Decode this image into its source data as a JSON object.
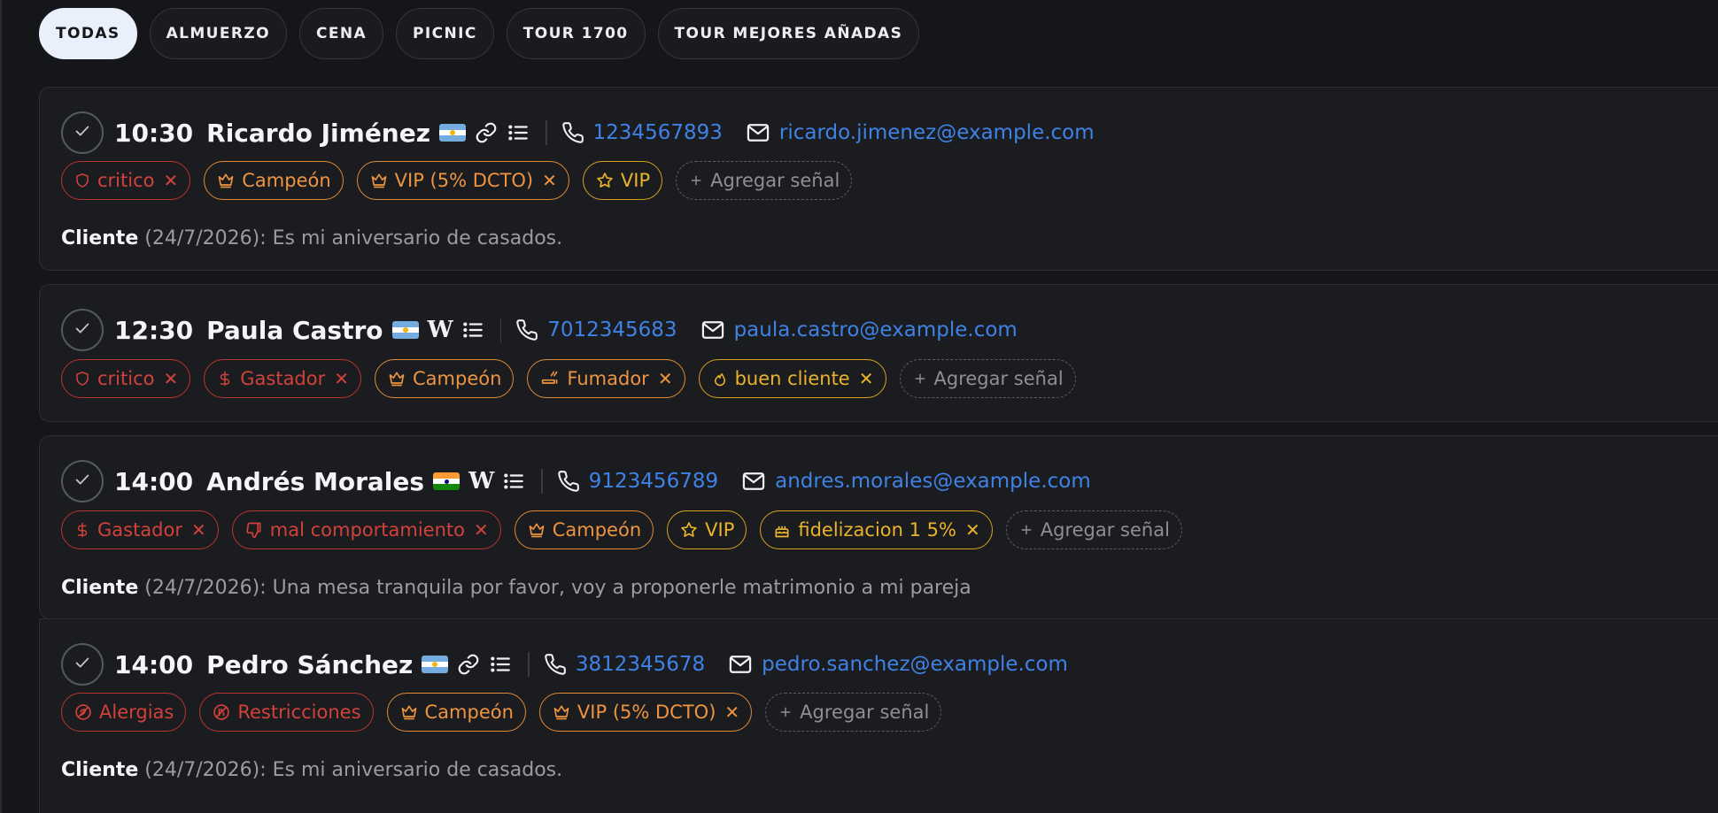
{
  "filters": [
    "TODAS",
    "ALMUERZO",
    "CENA",
    "PICNIC",
    "TOUR 1700",
    "TOUR MEJORES AÑADAS"
  ],
  "colors": {
    "red": "#d2413a",
    "orange": "#ee9440",
    "yellow": "#e9b32b",
    "link": "#3f82e6",
    "background": "#151619"
  },
  "add_signal_label": "Agregar señal",
  "reservations": [
    {
      "time": "10:30",
      "name": "Ricardo Jiménez",
      "flag": "argentina-flag",
      "icons": [
        "link-icon",
        "list-icon"
      ],
      "phone": "1234567893",
      "email": "ricardo.jimenez@example.com",
      "tags": [
        {
          "label": "critico",
          "color": "red",
          "icon": "shield-icon",
          "removable": true
        },
        {
          "label": "Campeón",
          "color": "orange",
          "icon": "crown-icon",
          "removable": false
        },
        {
          "label": "VIP (5% DCTO)",
          "color": "orange",
          "icon": "crown-icon",
          "removable": true
        },
        {
          "label": "VIP",
          "color": "yellow",
          "icon": "star-icon",
          "removable": false
        }
      ],
      "note": {
        "author": "Cliente",
        "date": "(24/7/2026):",
        "text": "Es mi aniversario de casados."
      }
    },
    {
      "time": "12:30",
      "name": "Paula Castro",
      "flag": "argentina-flag",
      "icons": [
        "w-icon",
        "list-icon"
      ],
      "phone": "7012345683",
      "email": "paula.castro@example.com",
      "tags": [
        {
          "label": "critico",
          "color": "red",
          "icon": "shield-icon",
          "removable": true
        },
        {
          "label": "Gastador",
          "color": "red",
          "icon": "dollar-icon",
          "removable": true
        },
        {
          "label": "Campeón",
          "color": "orange",
          "icon": "crown-icon",
          "removable": false
        },
        {
          "label": "Fumador",
          "color": "orange",
          "icon": "cigarette-icon",
          "removable": true
        },
        {
          "label": "buen cliente",
          "color": "yellow",
          "icon": "flame-icon",
          "removable": true
        }
      ]
    },
    {
      "time": "14:00",
      "name": "Andrés Morales",
      "flag": "india-flag",
      "icons": [
        "w-icon",
        "list-icon"
      ],
      "phone": "9123456789",
      "email": "andres.morales@example.com",
      "tags": [
        {
          "label": "Gastador",
          "color": "red",
          "icon": "dollar-icon",
          "removable": true
        },
        {
          "label": "mal comportamiento",
          "color": "red",
          "icon": "thumbs-down-icon",
          "removable": true
        },
        {
          "label": "Campeón",
          "color": "orange",
          "icon": "crown-icon",
          "removable": false
        },
        {
          "label": "VIP",
          "color": "yellow",
          "icon": "star-icon",
          "removable": false
        },
        {
          "label": "fidelizacion 1 5%",
          "color": "yellow",
          "icon": "cake-icon",
          "removable": true
        }
      ],
      "note": {
        "author": "Cliente",
        "date": "(24/7/2026):",
        "text": "Una mesa tranquila por favor, voy a proponerle matrimonio a mi pareja"
      }
    },
    {
      "time": "14:00",
      "name": "Pedro Sánchez",
      "flag": "argentina-flag",
      "icons": [
        "link-icon",
        "list-icon"
      ],
      "phone": "3812345678",
      "email": "pedro.sanchez@example.com",
      "tags": [
        {
          "label": "Alergias",
          "color": "red",
          "icon": "allergy-icon",
          "removable": false
        },
        {
          "label": "Restricciones",
          "color": "red",
          "icon": "restriction-icon",
          "removable": false
        },
        {
          "label": "Campeón",
          "color": "orange",
          "icon": "crown-icon",
          "removable": false
        },
        {
          "label": "VIP (5% DCTO)",
          "color": "orange",
          "icon": "crown-icon",
          "removable": true
        }
      ],
      "note": {
        "author": "Cliente",
        "date": "(24/7/2026):",
        "text": "Es mi aniversario de casados."
      }
    }
  ]
}
